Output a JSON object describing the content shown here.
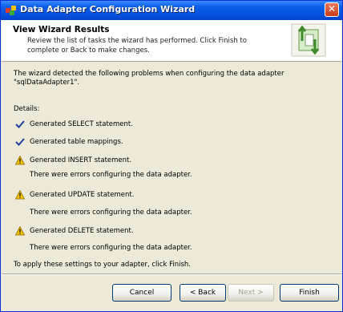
{
  "window": {
    "title": "Data Adapter Configuration Wizard",
    "close_glyph": "✕"
  },
  "header": {
    "title": "View Wizard Results",
    "description": "Review the list of tasks the wizard has performed. Click Finish to complete or Back to make changes."
  },
  "content": {
    "intro": "The wizard detected the following problems when configuring the data adapter \"sqlDataAdapter1\".",
    "details_label": "Details:",
    "items": [
      {
        "status": "ok",
        "icon": "check-icon",
        "text": "Generated SELECT statement."
      },
      {
        "status": "ok",
        "icon": "check-icon",
        "text": "Generated table mappings."
      },
      {
        "status": "warning",
        "icon": "warning-icon",
        "text": "Generated INSERT statement.",
        "detail": "There were errors configuring the data adapter."
      },
      {
        "status": "warning",
        "icon": "warning-icon",
        "text": "Generated UPDATE statement.",
        "detail": "There were errors configuring the data adapter."
      },
      {
        "status": "warning",
        "icon": "warning-icon",
        "text": "Generated DELETE statement.",
        "detail": "There were errors configuring the data adapter."
      }
    ],
    "footer": "To apply these settings to your adapter, click Finish."
  },
  "buttons": {
    "cancel": "Cancel",
    "back": "< Back",
    "next": "Next >",
    "finish": "Finish"
  },
  "colors": {
    "titlebar": "#0553e0",
    "check": "#1f3fa0",
    "warning": "#f5c400"
  }
}
